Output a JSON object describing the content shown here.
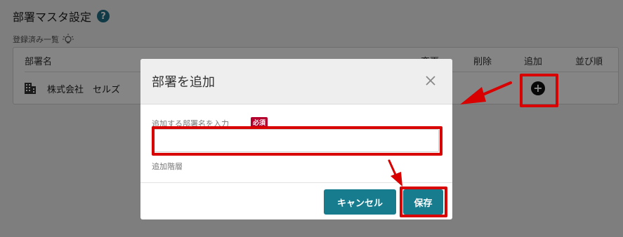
{
  "page": {
    "title": "部署マスタ設定",
    "help_icon": "?",
    "registered_label": "登録済み一覧"
  },
  "table": {
    "headers": {
      "name": "部署名",
      "change": "変更",
      "delete": "削除",
      "add": "追加",
      "order": "並び順"
    },
    "rows": [
      {
        "name": "株式会社　セルズ"
      }
    ]
  },
  "modal": {
    "title": "部署を追加",
    "field_label": "追加する部署名を入力",
    "required_badge": "必須",
    "input_value": "",
    "input_placeholder": "",
    "level_label": "追加階層",
    "cancel_label": "キャンセル",
    "save_label": "保存"
  },
  "colors": {
    "accent": "#167c8e",
    "highlight": "#d90000",
    "required": "#b3002d"
  },
  "icons": [
    "help-icon",
    "lightbulb-icon",
    "building-icon",
    "add-circle-icon",
    "close-icon",
    "annotation-arrow"
  ]
}
